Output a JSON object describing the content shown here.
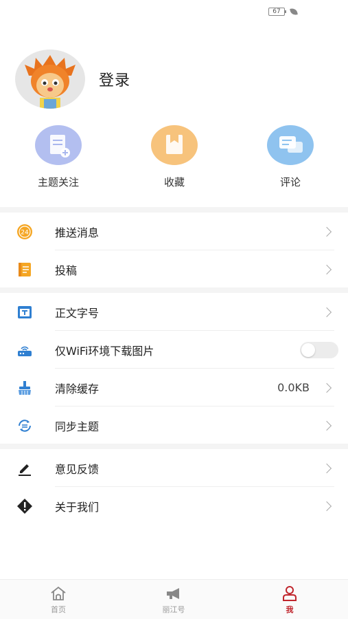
{
  "status_bar": {
    "battery": "67"
  },
  "profile": {
    "login_label": "登录"
  },
  "quick_actions": [
    {
      "label": "主题关注",
      "icon": "subscribe-topic-icon",
      "color": "#a9b7ee"
    },
    {
      "label": "收藏",
      "icon": "bookmark-icon",
      "color": "#f7c37c"
    },
    {
      "label": "评论",
      "icon": "comment-icon",
      "color": "#8fc3ef"
    }
  ],
  "menu": {
    "push": {
      "label": "推送消息",
      "icon": "push-24-icon"
    },
    "contribute": {
      "label": "投稿",
      "icon": "contribute-icon"
    },
    "font_size": {
      "label": "正文字号",
      "icon": "font-size-icon"
    },
    "wifi_only": {
      "label": "仅WiFi环境下载图片",
      "icon": "router-icon",
      "enabled": false
    },
    "clear_cache": {
      "label": "清除缓存",
      "icon": "broom-icon",
      "value": "0.0KB"
    },
    "sync_topics": {
      "label": "同步主题",
      "icon": "sync-icon"
    },
    "feedback": {
      "label": "意见反馈",
      "icon": "pen-icon"
    },
    "about": {
      "label": "关于我们",
      "icon": "warning-diamond-icon"
    }
  },
  "tabbar": [
    {
      "label": "首页",
      "icon": "home-icon",
      "active": false
    },
    {
      "label": "丽江号",
      "icon": "megaphone-icon",
      "active": false
    },
    {
      "label": "我",
      "icon": "person-icon",
      "active": true
    }
  ],
  "colors": {
    "accent": "#c0262d",
    "divider": "#f4f4f4"
  }
}
